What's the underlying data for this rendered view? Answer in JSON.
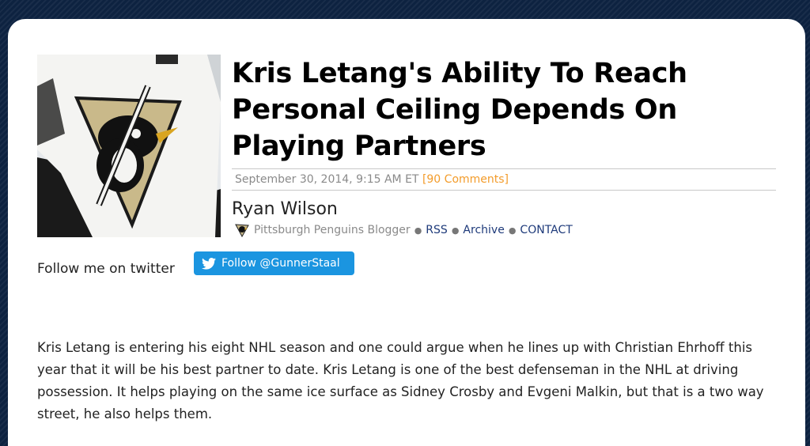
{
  "article": {
    "title": "Kris Letang's Ability To Reach Personal Ceiling Depends On Playing Partners",
    "date": "September 30, 2014, 9:15 AM ET",
    "comments": "[90 Comments]"
  },
  "author": {
    "name": "Ryan Wilson",
    "role": "Pittsburgh Penguins Blogger",
    "links": [
      "RSS",
      "Archive",
      "CONTACT"
    ]
  },
  "social": {
    "follow_text": "Follow me on twitter",
    "button_label": "Follow @GunnerStaal"
  },
  "body": {
    "paragraph": "Kris Letang is entering his eight NHL season and one could argue when he lines up with Christian Ehrhoff this year that it will be his best partner to date. Kris Letang is one of the best defenseman in the NHL at driving possession. It helps playing on the same ice surface as Sidney Crosby and Evgeni Malkin, but that is a two way street, he also helps them."
  },
  "colors": {
    "background": "#0d2240",
    "comments": "#f39c2b",
    "link": "#1e3a7a",
    "twitter": "#1b95e0"
  }
}
